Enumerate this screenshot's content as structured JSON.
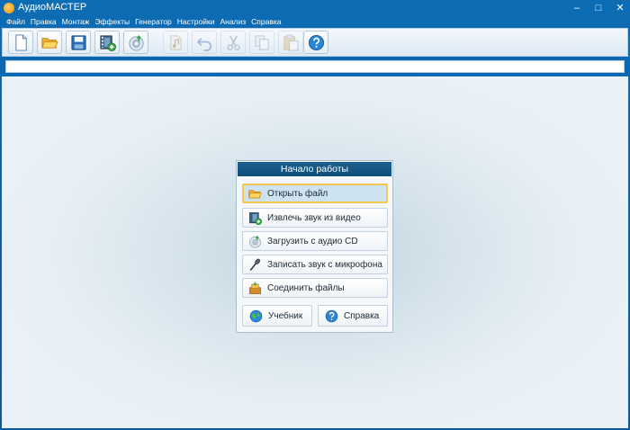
{
  "window": {
    "title": "АудиоМАСТЕР"
  },
  "window_controls": {
    "minimize": "–",
    "maximize": "□",
    "close": "✕"
  },
  "menu": {
    "items": [
      "Файл",
      "Правка",
      "Монтаж",
      "Эффекты",
      "Генератор",
      "Настройки",
      "Анализ",
      "Справка"
    ]
  },
  "toolbar": {
    "buttons": [
      {
        "icon": "new-file-icon",
        "enabled": true
      },
      {
        "icon": "open-folder-icon",
        "enabled": true
      },
      {
        "icon": "save-disk-icon",
        "enabled": true
      },
      {
        "icon": "video-extract-icon",
        "enabled": true
      },
      {
        "icon": "cd-load-icon",
        "enabled": true
      },
      {
        "icon": "audio-file-icon",
        "enabled": false
      },
      {
        "icon": "undo-icon",
        "enabled": false
      },
      {
        "icon": "scissors-icon",
        "enabled": false
      },
      {
        "icon": "copy-icon",
        "enabled": false
      },
      {
        "icon": "paste-icon",
        "enabled": false
      },
      {
        "icon": "help-icon",
        "enabled": true
      }
    ]
  },
  "start_panel": {
    "title": "Начало работы",
    "actions": [
      {
        "label": "Открыть файл",
        "icon": "open-folder-icon",
        "selected": true
      },
      {
        "label": "Извлечь звук из видео",
        "icon": "video-extract-icon",
        "selected": false
      },
      {
        "label": "Загрузить с аудио CD",
        "icon": "cd-load-icon",
        "selected": false
      },
      {
        "label": "Записать звук с микрофона",
        "icon": "microphone-icon",
        "selected": false
      },
      {
        "label": "Соединить файлы",
        "icon": "join-files-icon",
        "selected": false
      }
    ],
    "tutorial_label": "Учебник",
    "help_label": "Справка"
  },
  "colors": {
    "window_blue": "#0a5fa6",
    "panel_header": "#155687",
    "highlight_border": "#f2c94c",
    "highlight_fill": "#cde4f0"
  }
}
